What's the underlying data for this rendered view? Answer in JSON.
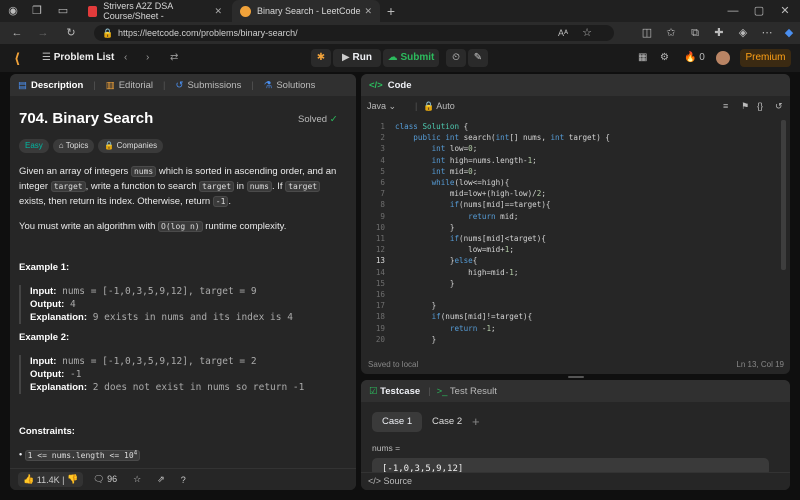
{
  "browser": {
    "tabs": [
      {
        "title": "Strivers A2Z DSA Course/Sheet -",
        "favicon_color": "#e23b3b"
      },
      {
        "title": "Binary Search - LeetCode",
        "favicon_color": "#f0a23a"
      }
    ],
    "url": "https://leetcode.com/problems/binary-search/"
  },
  "nav": {
    "problem_list": "Problem List",
    "run": "Run",
    "submit": "Submit",
    "streak": "0",
    "premium": "Premium"
  },
  "left": {
    "tabs": {
      "description": "Description",
      "editorial": "Editorial",
      "submissions": "Submissions",
      "solutions": "Solutions"
    },
    "title": "704. Binary Search",
    "solved": "Solved",
    "difficulty": "Easy",
    "topics": "Topics",
    "companies": "Companies",
    "p1": {
      "a": "Given an array of integers ",
      "b": "nums",
      "c": " which is sorted in ascending order, and an integer ",
      "d": "target",
      "e": ", write a function to search ",
      "f": "target",
      "g": " in ",
      "h": "nums",
      "i": ". If ",
      "j": "target",
      "k": " exists, then return its index. Otherwise, return ",
      "l": "-1",
      "m": "."
    },
    "p2": {
      "a": "You must write an algorithm with ",
      "b": "O(log n)",
      "c": " runtime complexity."
    },
    "ex1": {
      "heading": "Example 1:",
      "input_label": "Input:",
      "input": " nums = [-1,0,3,5,9,12], target = 9",
      "output_label": "Output:",
      "output": " 4",
      "expl_label": "Explanation:",
      "expl": " 9 exists in nums and its index is 4"
    },
    "ex2": {
      "heading": "Example 2:",
      "input_label": "Input:",
      "input": " nums = [-1,0,3,5,9,12], target = 2",
      "output_label": "Output:",
      "output": " -1",
      "expl_label": "Explanation:",
      "expl": " 2 does not exist in nums so return -1"
    },
    "constraints_heading": "Constraints:",
    "constraint1": "1 <= nums.length <= 10",
    "constraint1_sup": "4",
    "likes": "11.4K",
    "comments": "96"
  },
  "code": {
    "title": "Code",
    "language": "Java",
    "auto": "Auto",
    "lines": [
      "class Solution {",
      "    public int search(int[] nums, int target) {",
      "        int low=0;",
      "        int high=nums.length-1;",
      "        int mid=0;",
      "        while(low<=high){",
      "            mid=low+(high-low)/2;",
      "            if(nums[mid]==target){",
      "                return mid;",
      "            }",
      "            if(nums[mid]<target){",
      "                low=mid+1;",
      "            }else{",
      "                high=mid-1;",
      "            }",
      "        ",
      "        }",
      "        if(nums[mid]!=target){",
      "            return -1;",
      "        }"
    ],
    "line_numbers": [
      "1",
      "2",
      "3",
      "4",
      "5",
      "6",
      "7",
      "8",
      "9",
      "10",
      "11",
      "12",
      "13",
      "14",
      "15",
      "16",
      "17",
      "18",
      "19",
      "20"
    ],
    "saved": "Saved to local",
    "cursor": "Ln 13, Col 19"
  },
  "test": {
    "tab_testcase": "Testcase",
    "tab_result": "Test Result",
    "case1": "Case 1",
    "case2": "Case 2",
    "add": "+",
    "var_label": "nums =",
    "var_value": "[-1,0,3,5,9,12]",
    "source": "Source"
  }
}
